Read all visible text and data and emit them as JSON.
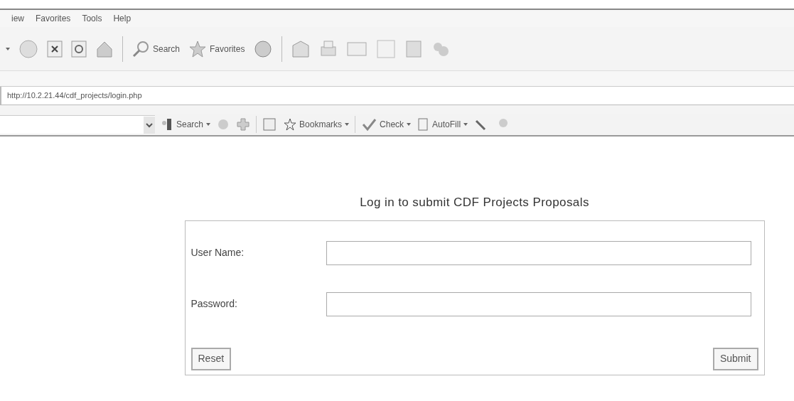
{
  "menu_bar": [
    "iew",
    "Favorites",
    "Tools",
    "Help"
  ],
  "toolbar": {
    "search_label": "Search",
    "favorites_label": "Favorites"
  },
  "address_bar": {
    "url": "http://10.2.21.44/cdf_projects/login.php"
  },
  "search_toolbar": {
    "search_label": "Search",
    "bookmarks_label": "Bookmarks",
    "check_label": "Check",
    "autofill_label": "AutoFill"
  },
  "form": {
    "title": "Log in to submit CDF Projects Proposals",
    "fields": [
      {
        "label": "User Name:"
      },
      {
        "label": "Password:"
      }
    ],
    "buttons": [
      "Reset",
      "Submit"
    ]
  }
}
